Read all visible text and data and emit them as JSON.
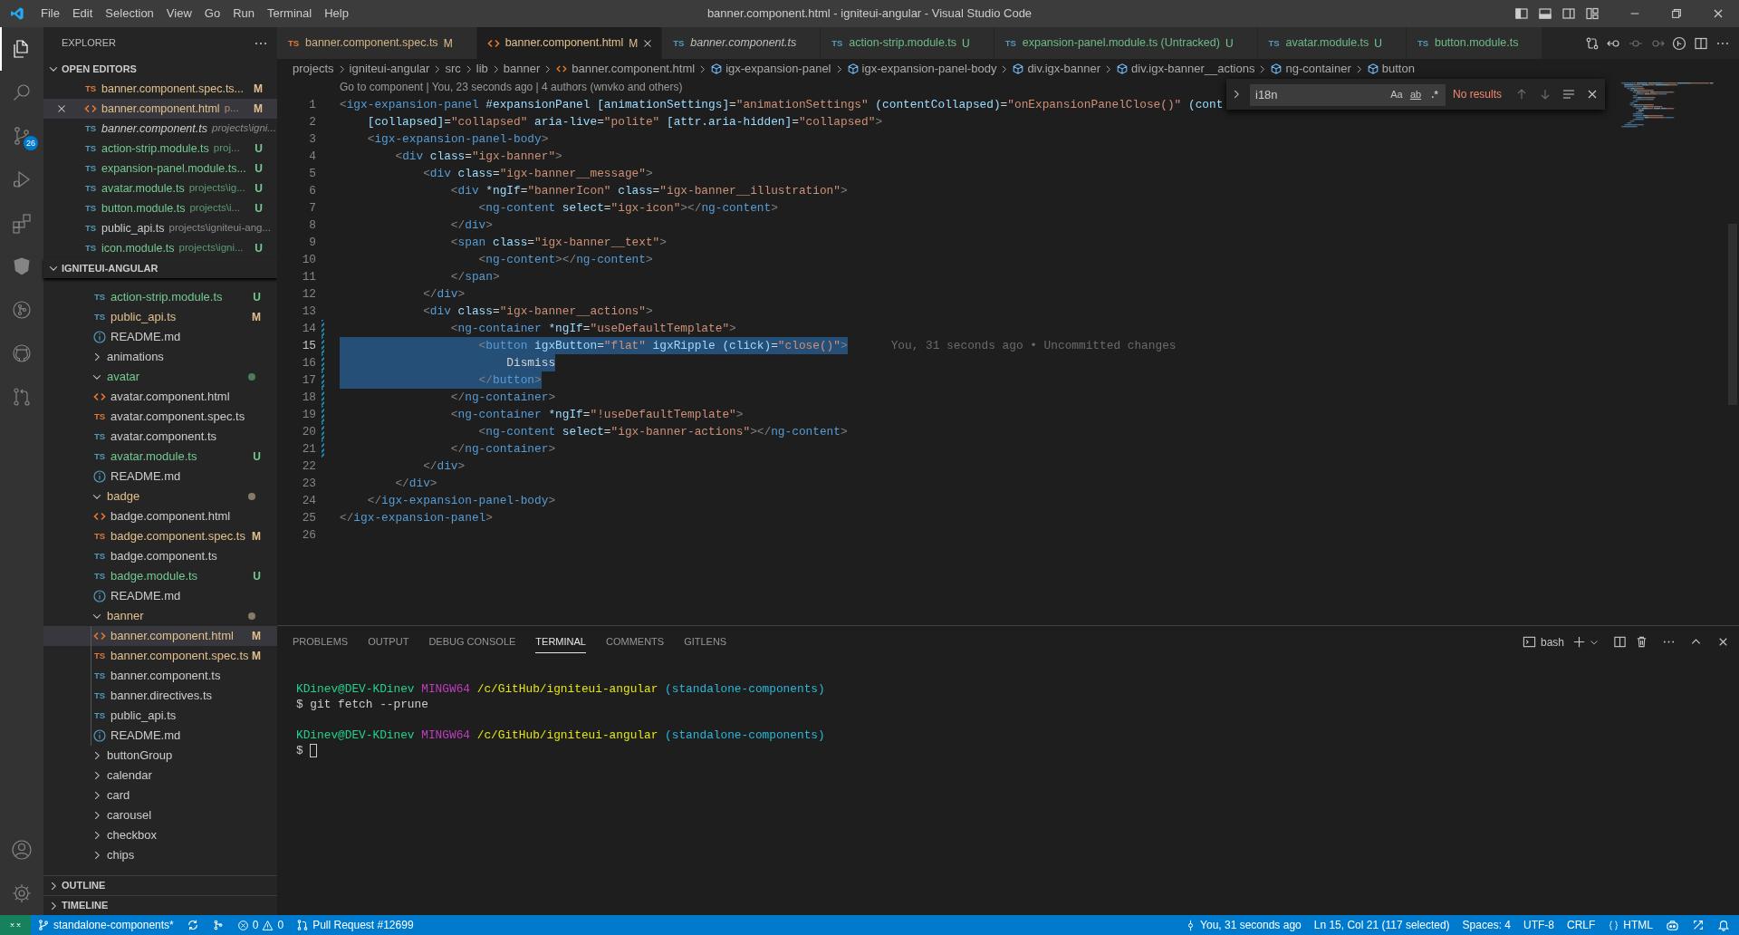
{
  "title_bar": {
    "menus": [
      "File",
      "Edit",
      "Selection",
      "View",
      "Go",
      "Run",
      "Terminal",
      "Help"
    ],
    "title": "banner.component.html - igniteui-angular - Visual Studio Code"
  },
  "activity_bar": {
    "top": [
      {
        "kind": "files",
        "selected": true
      },
      {
        "kind": "search",
        "selected": false
      },
      {
        "kind": "scm",
        "selected": false,
        "badge": "26"
      },
      {
        "kind": "debug",
        "selected": false
      },
      {
        "kind": "extensions",
        "selected": false
      },
      {
        "kind": "angular",
        "selected": false
      },
      {
        "kind": "gitlens",
        "selected": false
      },
      {
        "kind": "github",
        "selected": false
      },
      {
        "kind": "pr",
        "selected": false
      }
    ],
    "bottom": [
      {
        "kind": "account"
      },
      {
        "kind": "settings"
      }
    ]
  },
  "sidebar": {
    "title": "EXPLORER",
    "open_editors": {
      "title": "OPEN EDITORS",
      "expanded": true,
      "items": [
        {
          "label": "banner.component.spec.ts...",
          "kind": "spec",
          "icon_text": "TS",
          "modified": true,
          "untracked": false,
          "status": "M",
          "preview": false,
          "selected": false
        },
        {
          "label": "banner.component.html",
          "description": "p...",
          "kind": "html",
          "modified": true,
          "untracked": false,
          "status": "M",
          "preview": false,
          "selected": true
        },
        {
          "label": "banner.component.ts",
          "description": "projects\\igni...",
          "kind": "ts",
          "icon_text": "TS",
          "modified": false,
          "untracked": false,
          "preview": true,
          "selected": false
        },
        {
          "label": "action-strip.module.ts",
          "description": "proj...",
          "kind": "ts",
          "icon_text": "TS",
          "modified": false,
          "untracked": true,
          "status": "U",
          "preview": false,
          "selected": false
        },
        {
          "label": "expansion-panel.module.ts...",
          "kind": "ts",
          "icon_text": "TS",
          "modified": false,
          "untracked": true,
          "status": "U",
          "preview": false,
          "selected": false
        },
        {
          "label": "avatar.module.ts",
          "description": "projects\\ig...",
          "kind": "ts",
          "icon_text": "TS",
          "modified": false,
          "untracked": true,
          "status": "U",
          "preview": false,
          "selected": false
        },
        {
          "label": "button.module.ts",
          "description": "projects\\i...",
          "kind": "ts",
          "icon_text": "TS",
          "modified": false,
          "untracked": true,
          "status": "U",
          "preview": false,
          "selected": false
        },
        {
          "label": "public_api.ts",
          "description": "projects\\igniteui-ang...",
          "kind": "ts",
          "icon_text": "TS",
          "modified": false,
          "untracked": false,
          "preview": false,
          "selected": false
        },
        {
          "label": "icon.module.ts",
          "description": "projects\\igni...",
          "kind": "ts",
          "icon_text": "TS",
          "modified": false,
          "untracked": true,
          "status": "U",
          "preview": false,
          "selected": false
        }
      ]
    },
    "project": {
      "title": "IGNITEUI-ANGULAR",
      "expanded": true,
      "items": [
        {
          "kind": "ts",
          "label": "action-strip.module.ts",
          "icon_text": "TS",
          "modified": false,
          "untracked": true,
          "status": "U",
          "selected": false
        },
        {
          "kind": "ts",
          "label": "public_api.ts",
          "icon_text": "TS",
          "modified": true,
          "untracked": false,
          "status": "M",
          "selected": false
        },
        {
          "kind": "info",
          "label": "README.md",
          "modified": false,
          "untracked": false,
          "selected": false
        },
        {
          "kind": "folder",
          "label": "animations",
          "expanded": false,
          "modified": false,
          "untracked": false,
          "selected": false
        },
        {
          "kind": "folder",
          "label": "avatar",
          "expanded": true,
          "modified": false,
          "untracked": true,
          "selected": false,
          "children": [
            {
              "kind": "html",
              "label": "avatar.component.html",
              "modified": false,
              "untracked": false,
              "selected": false
            },
            {
              "kind": "spec",
              "label": "avatar.component.spec.ts",
              "icon_text": "TS",
              "modified": false,
              "untracked": false,
              "selected": false
            },
            {
              "kind": "ts",
              "label": "avatar.component.ts",
              "icon_text": "TS",
              "modified": false,
              "untracked": false,
              "selected": false
            },
            {
              "kind": "ts",
              "label": "avatar.module.ts",
              "icon_text": "TS",
              "modified": false,
              "untracked": true,
              "status": "U",
              "selected": false
            },
            {
              "kind": "info",
              "label": "README.md",
              "modified": false,
              "untracked": false,
              "selected": false
            }
          ]
        },
        {
          "kind": "folder",
          "label": "badge",
          "expanded": true,
          "modified": true,
          "untracked": false,
          "selected": false,
          "children": [
            {
              "kind": "html",
              "label": "badge.component.html",
              "modified": false,
              "untracked": false,
              "selected": false
            },
            {
              "kind": "spec",
              "label": "badge.component.spec.ts",
              "icon_text": "TS",
              "modified": true,
              "untracked": false,
              "status": "M",
              "selected": false
            },
            {
              "kind": "ts",
              "label": "badge.component.ts",
              "icon_text": "TS",
              "modified": false,
              "untracked": false,
              "selected": false
            },
            {
              "kind": "ts",
              "label": "badge.module.ts",
              "icon_text": "TS",
              "modified": false,
              "untracked": true,
              "status": "U",
              "selected": false
            },
            {
              "kind": "info",
              "label": "README.md",
              "modified": false,
              "untracked": false,
              "selected": false
            }
          ]
        },
        {
          "kind": "folder",
          "label": "banner",
          "expanded": true,
          "modified": true,
          "untracked": false,
          "selected": false,
          "children": [
            {
              "kind": "html",
              "label": "banner.component.html",
              "modified": true,
              "untracked": false,
              "status": "M",
              "selected": true
            },
            {
              "kind": "spec",
              "label": "banner.component.spec.ts",
              "icon_text": "TS",
              "modified": true,
              "untracked": false,
              "status": "M",
              "selected": false
            },
            {
              "kind": "ts",
              "label": "banner.component.ts",
              "icon_text": "TS",
              "modified": false,
              "untracked": false,
              "selected": false
            },
            {
              "kind": "ts",
              "label": "banner.directives.ts",
              "icon_text": "TS",
              "modified": false,
              "untracked": false,
              "selected": false
            },
            {
              "kind": "ts",
              "label": "public_api.ts",
              "icon_text": "TS",
              "modified": false,
              "untracked": false,
              "selected": false
            },
            {
              "kind": "info",
              "label": "README.md",
              "modified": false,
              "untracked": false,
              "selected": false
            }
          ]
        },
        {
          "kind": "folder",
          "label": "buttonGroup",
          "expanded": false,
          "modified": false,
          "untracked": false,
          "selected": false
        },
        {
          "kind": "folder",
          "label": "calendar",
          "expanded": false,
          "modified": false,
          "untracked": false,
          "selected": false
        },
        {
          "kind": "folder",
          "label": "card",
          "expanded": false,
          "modified": false,
          "untracked": false,
          "selected": false
        },
        {
          "kind": "folder",
          "label": "carousel",
          "expanded": false,
          "modified": false,
          "untracked": false,
          "selected": false
        },
        {
          "kind": "folder",
          "label": "checkbox",
          "expanded": false,
          "modified": false,
          "untracked": false,
          "selected": false
        },
        {
          "kind": "folder",
          "label": "chips",
          "expanded": false,
          "modified": false,
          "untracked": false,
          "selected": false
        }
      ]
    },
    "sections": [
      {
        "title": "OUTLINE",
        "expanded": false
      },
      {
        "title": "TIMELINE",
        "expanded": false
      }
    ]
  },
  "tabs": [
    {
      "label": "banner.component.spec.ts",
      "kind": "spec",
      "icon_text": "TS",
      "modified": true,
      "untracked": false,
      "status": "M",
      "preview": false,
      "selected": false
    },
    {
      "label": "banner.component.html",
      "kind": "html",
      "modified": true,
      "untracked": false,
      "status": "M",
      "preview": false,
      "selected": true
    },
    {
      "label": "banner.component.ts",
      "kind": "ts",
      "icon_text": "TS",
      "modified": false,
      "untracked": false,
      "preview": true,
      "selected": false
    },
    {
      "label": "action-strip.module.ts",
      "kind": "ts",
      "icon_text": "TS",
      "modified": false,
      "untracked": true,
      "status": "U",
      "preview": false,
      "selected": false
    },
    {
      "label": "expansion-panel.module.ts (Untracked)",
      "kind": "ts",
      "icon_text": "TS",
      "modified": false,
      "untracked": true,
      "status": "U",
      "preview": false,
      "selected": false
    },
    {
      "label": "avatar.module.ts",
      "kind": "ts",
      "icon_text": "TS",
      "modified": false,
      "untracked": true,
      "status": "U",
      "preview": false,
      "selected": false
    },
    {
      "label": "button.module.ts",
      "kind": "ts",
      "icon_text": "TS",
      "modified": false,
      "untracked": true,
      "preview": false,
      "selected": false
    }
  ],
  "breadcrumbs": [
    {
      "kind": "folder",
      "label": "projects"
    },
    {
      "kind": "folder",
      "label": "igniteui-angular"
    },
    {
      "kind": "folder",
      "label": "src"
    },
    {
      "kind": "folder",
      "label": "lib"
    },
    {
      "kind": "folder",
      "label": "banner"
    },
    {
      "kind": "file",
      "label": "banner.component.html"
    },
    {
      "kind": "symbol",
      "label": "igx-expansion-panel"
    },
    {
      "kind": "symbol",
      "label": "igx-expansion-panel-body"
    },
    {
      "kind": "symbol",
      "label": "div.igx-banner"
    },
    {
      "kind": "symbol",
      "label": "div.igx-banner__actions"
    },
    {
      "kind": "symbol",
      "label": "ng-container"
    },
    {
      "kind": "symbol",
      "label": "button"
    }
  ],
  "editor": {
    "codelens": "Go to component | You, 23 seconds ago | 4 authors (wnvko and others)",
    "lines": [
      {
        "n": "1",
        "tokens": [
          {
            "kind": "punct",
            "text": "<"
          },
          {
            "kind": "tag",
            "text": "igx-expansion-panel"
          },
          {
            "kind": "attr",
            "text": " #expansionPanel"
          },
          {
            "kind": "attr",
            "text": " [animationSettings]"
          },
          {
            "kind": "text",
            "text": "="
          },
          {
            "kind": "string",
            "text": "\"animationSettings\""
          },
          {
            "kind": "attr",
            "text": " (contentCollapsed)"
          },
          {
            "kind": "text",
            "text": "="
          },
          {
            "kind": "string",
            "text": "\"onExpansionPanelClose()\""
          },
          {
            "kind": "attr",
            "text": " (cont"
          }
        ],
        "modified": false,
        "selected": false,
        "current": false
      },
      {
        "n": "2",
        "tokens": [
          {
            "kind": "attr",
            "text": "    [collapsed]"
          },
          {
            "kind": "text",
            "text": "="
          },
          {
            "kind": "string",
            "text": "\"collapsed\""
          },
          {
            "kind": "attr",
            "text": " aria-live"
          },
          {
            "kind": "text",
            "text": "="
          },
          {
            "kind": "string",
            "text": "\"polite\""
          },
          {
            "kind": "attr",
            "text": " [attr.aria-hidden]"
          },
          {
            "kind": "text",
            "text": "="
          },
          {
            "kind": "string",
            "text": "\"collapsed\""
          },
          {
            "kind": "punct",
            "text": ">"
          }
        ],
        "modified": false,
        "selected": false,
        "current": false
      },
      {
        "n": "3",
        "tokens": [
          {
            "kind": "punct",
            "text": "    <"
          },
          {
            "kind": "tag",
            "text": "igx-expansion-panel-body"
          },
          {
            "kind": "punct",
            "text": ">"
          }
        ],
        "modified": false,
        "selected": false,
        "current": false
      },
      {
        "n": "4",
        "tokens": [
          {
            "kind": "punct",
            "text": "        <"
          },
          {
            "kind": "tag",
            "text": "div"
          },
          {
            "kind": "attr",
            "text": " class"
          },
          {
            "kind": "text",
            "text": "="
          },
          {
            "kind": "string",
            "text": "\"igx-banner\""
          },
          {
            "kind": "punct",
            "text": ">"
          }
        ],
        "modified": false,
        "selected": false,
        "current": false
      },
      {
        "n": "5",
        "tokens": [
          {
            "kind": "punct",
            "text": "            <"
          },
          {
            "kind": "tag",
            "text": "div"
          },
          {
            "kind": "attr",
            "text": " class"
          },
          {
            "kind": "text",
            "text": "="
          },
          {
            "kind": "string",
            "text": "\"igx-banner__message\""
          },
          {
            "kind": "punct",
            "text": ">"
          }
        ],
        "modified": false,
        "selected": false,
        "current": false
      },
      {
        "n": "6",
        "tokens": [
          {
            "kind": "punct",
            "text": "                <"
          },
          {
            "kind": "tag",
            "text": "div"
          },
          {
            "kind": "attr",
            "text": " *ngIf"
          },
          {
            "kind": "text",
            "text": "="
          },
          {
            "kind": "string",
            "text": "\"bannerIcon\""
          },
          {
            "kind": "attr",
            "text": " class"
          },
          {
            "kind": "text",
            "text": "="
          },
          {
            "kind": "string",
            "text": "\"igx-banner__illustration\""
          },
          {
            "kind": "punct",
            "text": ">"
          }
        ],
        "modified": false,
        "selected": false,
        "current": false
      },
      {
        "n": "7",
        "tokens": [
          {
            "kind": "punct",
            "text": "                    <"
          },
          {
            "kind": "tag",
            "text": "ng-content"
          },
          {
            "kind": "attr",
            "text": " select"
          },
          {
            "kind": "text",
            "text": "="
          },
          {
            "kind": "string",
            "text": "\"igx-icon\""
          },
          {
            "kind": "punct",
            "text": "></"
          },
          {
            "kind": "tag",
            "text": "ng-content"
          },
          {
            "kind": "punct",
            "text": ">"
          }
        ],
        "modified": false,
        "selected": false,
        "current": false
      },
      {
        "n": "8",
        "tokens": [
          {
            "kind": "punct",
            "text": "                </"
          },
          {
            "kind": "tag",
            "text": "div"
          },
          {
            "kind": "punct",
            "text": ">"
          }
        ],
        "modified": false,
        "selected": false,
        "current": false
      },
      {
        "n": "9",
        "tokens": [
          {
            "kind": "punct",
            "text": "                <"
          },
          {
            "kind": "tag",
            "text": "span"
          },
          {
            "kind": "attr",
            "text": " class"
          },
          {
            "kind": "text",
            "text": "="
          },
          {
            "kind": "string",
            "text": "\"igx-banner__text\""
          },
          {
            "kind": "punct",
            "text": ">"
          }
        ],
        "modified": false,
        "selected": false,
        "current": false
      },
      {
        "n": "10",
        "tokens": [
          {
            "kind": "punct",
            "text": "                    <"
          },
          {
            "kind": "tag",
            "text": "ng-content"
          },
          {
            "kind": "punct",
            "text": "></"
          },
          {
            "kind": "tag",
            "text": "ng-content"
          },
          {
            "kind": "punct",
            "text": ">"
          }
        ],
        "modified": false,
        "selected": false,
        "current": false
      },
      {
        "n": "11",
        "tokens": [
          {
            "kind": "punct",
            "text": "                </"
          },
          {
            "kind": "tag",
            "text": "span"
          },
          {
            "kind": "punct",
            "text": ">"
          }
        ],
        "modified": false,
        "selected": false,
        "current": false
      },
      {
        "n": "12",
        "tokens": [
          {
            "kind": "punct",
            "text": "            </"
          },
          {
            "kind": "tag",
            "text": "div"
          },
          {
            "kind": "punct",
            "text": ">"
          }
        ],
        "modified": false,
        "selected": false,
        "current": false
      },
      {
        "n": "13",
        "tokens": [
          {
            "kind": "punct",
            "text": "            <"
          },
          {
            "kind": "tag",
            "text": "div"
          },
          {
            "kind": "attr",
            "text": " class"
          },
          {
            "kind": "text",
            "text": "="
          },
          {
            "kind": "string",
            "text": "\"igx-banner__actions\""
          },
          {
            "kind": "punct",
            "text": ">"
          }
        ],
        "modified": false,
        "selected": false,
        "current": false
      },
      {
        "n": "14",
        "tokens": [
          {
            "kind": "punct",
            "text": "                <"
          },
          {
            "kind": "tag",
            "text": "ng-container"
          },
          {
            "kind": "attr",
            "text": " *ngIf"
          },
          {
            "kind": "text",
            "text": "="
          },
          {
            "kind": "string",
            "text": "\"useDefaultTemplate\""
          },
          {
            "kind": "punct",
            "text": ">"
          }
        ],
        "modified": true,
        "selected": false,
        "current": false
      },
      {
        "n": "15",
        "tokens": [
          {
            "kind": "punct",
            "text": "                    <"
          },
          {
            "kind": "tag",
            "text": "button"
          },
          {
            "kind": "attr",
            "text": " igxButton"
          },
          {
            "kind": "text",
            "text": "="
          },
          {
            "kind": "string",
            "text": "\"flat\""
          },
          {
            "kind": "attr",
            "text": " igxRipple"
          },
          {
            "kind": "attr",
            "text": " (click)"
          },
          {
            "kind": "text",
            "text": "="
          },
          {
            "kind": "string",
            "text": "\"close()\""
          },
          {
            "kind": "punct",
            "text": ">"
          }
        ],
        "modified": true,
        "selected": true,
        "current": true,
        "blame": "You, 31 seconds ago • Uncommitted changes"
      },
      {
        "n": "16",
        "tokens": [
          {
            "kind": "text",
            "text": "                        Dismiss"
          }
        ],
        "modified": true,
        "selected": true,
        "current": false
      },
      {
        "n": "17",
        "tokens": [
          {
            "kind": "punct",
            "text": "                    </"
          },
          {
            "kind": "tag",
            "text": "button"
          },
          {
            "kind": "punct",
            "text": ">"
          }
        ],
        "modified": true,
        "selected": true,
        "current": false
      },
      {
        "n": "18",
        "tokens": [
          {
            "kind": "punct",
            "text": "                </"
          },
          {
            "kind": "tag",
            "text": "ng-container"
          },
          {
            "kind": "punct",
            "text": ">"
          }
        ],
        "modified": true,
        "selected": false,
        "current": false
      },
      {
        "n": "19",
        "tokens": [
          {
            "kind": "punct",
            "text": "                <"
          },
          {
            "kind": "tag",
            "text": "ng-container"
          },
          {
            "kind": "attr",
            "text": " *ngIf"
          },
          {
            "kind": "text",
            "text": "="
          },
          {
            "kind": "string",
            "text": "\"!useDefaultTemplate\""
          },
          {
            "kind": "punct",
            "text": ">"
          }
        ],
        "modified": true,
        "selected": false,
        "current": false
      },
      {
        "n": "20",
        "tokens": [
          {
            "kind": "punct",
            "text": "                    <"
          },
          {
            "kind": "tag",
            "text": "ng-content"
          },
          {
            "kind": "attr",
            "text": " select"
          },
          {
            "kind": "text",
            "text": "="
          },
          {
            "kind": "string",
            "text": "\"igx-banner-actions\""
          },
          {
            "kind": "punct",
            "text": "></"
          },
          {
            "kind": "tag",
            "text": "ng-content"
          },
          {
            "kind": "punct",
            "text": ">"
          }
        ],
        "modified": true,
        "selected": false,
        "current": false
      },
      {
        "n": "21",
        "tokens": [
          {
            "kind": "punct",
            "text": "                </"
          },
          {
            "kind": "tag",
            "text": "ng-container"
          },
          {
            "kind": "punct",
            "text": ">"
          }
        ],
        "modified": true,
        "selected": false,
        "current": false
      },
      {
        "n": "22",
        "tokens": [
          {
            "kind": "punct",
            "text": "            </"
          },
          {
            "kind": "tag",
            "text": "div"
          },
          {
            "kind": "punct",
            "text": ">"
          }
        ],
        "modified": false,
        "selected": false,
        "current": false
      },
      {
        "n": "23",
        "tokens": [
          {
            "kind": "punct",
            "text": "        </"
          },
          {
            "kind": "tag",
            "text": "div"
          },
          {
            "kind": "punct",
            "text": ">"
          }
        ],
        "modified": false,
        "selected": false,
        "current": false
      },
      {
        "n": "24",
        "tokens": [
          {
            "kind": "punct",
            "text": "    </"
          },
          {
            "kind": "tag",
            "text": "igx-expansion-panel-body"
          },
          {
            "kind": "punct",
            "text": ">"
          }
        ],
        "modified": false,
        "selected": false,
        "current": false
      },
      {
        "n": "25",
        "tokens": [
          {
            "kind": "punct",
            "text": "</"
          },
          {
            "kind": "tag",
            "text": "igx-expansion-panel"
          },
          {
            "kind": "punct",
            "text": ">"
          }
        ],
        "modified": false,
        "selected": false,
        "current": false
      },
      {
        "n": "26",
        "modified": false,
        "current": false
      }
    ],
    "find": {
      "value": "i18n",
      "options": [
        {
          "kind": "case",
          "label": "Aa"
        },
        {
          "kind": "word",
          "label": "ab"
        },
        {
          "kind": "regex",
          "label": ".*"
        }
      ],
      "result": "No results"
    }
  },
  "panel": {
    "tabs": [
      {
        "label": "PROBLEMS",
        "selected": false
      },
      {
        "label": "OUTPUT",
        "selected": false
      },
      {
        "label": "DEBUG CONSOLE",
        "selected": false
      },
      {
        "label": "TERMINAL",
        "selected": true
      },
      {
        "label": "COMMENTS",
        "selected": false
      },
      {
        "label": "GITLENS",
        "selected": false
      }
    ],
    "shell": "bash",
    "blocks": [
      {
        "lines": [
          [
            {
              "kind": "user",
              "text": "KDinev@DEV-KDinev"
            },
            {
              "kind": "host",
              "text": "MINGW64"
            },
            {
              "kind": "path",
              "text": "/c/GitHub/igniteui-angular"
            },
            {
              "kind": "branch",
              "text": "(standalone-components)"
            }
          ],
          [
            {
              "kind": "text",
              "text": "$ git fetch --prune"
            }
          ]
        ]
      },
      {
        "lines": [
          [
            {
              "kind": "user",
              "text": "KDinev@DEV-KDinev"
            },
            {
              "kind": "host",
              "text": "MINGW64"
            },
            {
              "kind": "path",
              "text": "/c/GitHub/igniteui-angular"
            },
            {
              "kind": "branch",
              "text": "(standalone-components)"
            }
          ],
          [
            {
              "kind": "text",
              "text": "$"
            },
            {
              "kind": "cursor"
            }
          ]
        ]
      }
    ]
  },
  "status_bar": {
    "left": [
      {
        "kind": "remote"
      },
      {
        "kind": "branch",
        "label": "standalone-components*"
      },
      {
        "kind": "sync"
      },
      {
        "kind": "gitlens"
      },
      {
        "kind": "problems",
        "errors": "0",
        "warnings": "0"
      },
      {
        "kind": "pr",
        "label": "Pull Request #12699"
      }
    ],
    "right": [
      {
        "kind": "blame",
        "label": "You, 31 seconds ago"
      },
      {
        "kind": "text",
        "label": "Ln 15, Col 21 (117 selected)"
      },
      {
        "kind": "text",
        "label": "Spaces: 4"
      },
      {
        "kind": "text",
        "label": "UTF-8"
      },
      {
        "kind": "text",
        "label": "CRLF"
      },
      {
        "kind": "language",
        "label": "HTML"
      },
      {
        "kind": "copilot"
      },
      {
        "kind": "feedback"
      },
      {
        "kind": "bell"
      }
    ]
  }
}
